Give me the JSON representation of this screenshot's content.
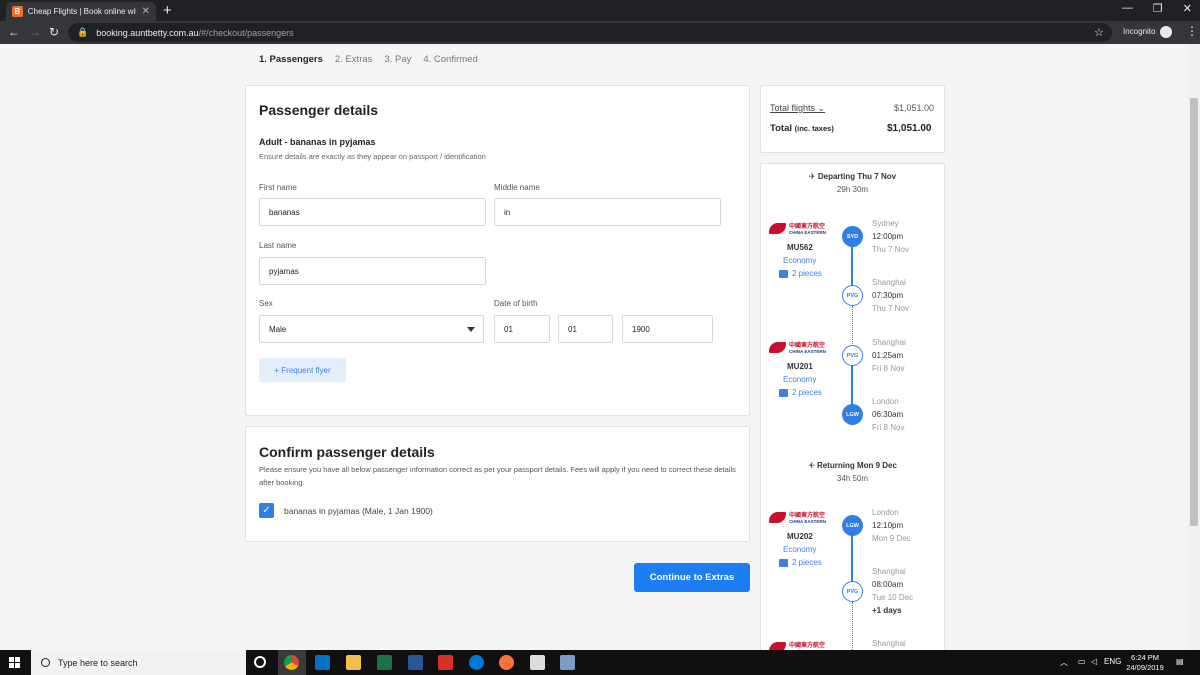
{
  "browser": {
    "tab_title": "Cheap Flights | Book online with",
    "tab_icon_letter": "B",
    "url_host": "booking.auntbetty.com.au",
    "url_path": "/#/checkout/passengers",
    "incognito_label": "Incognito"
  },
  "steps": [
    {
      "label": "1.  Passengers",
      "active": true
    },
    {
      "label": "2.  Extras",
      "active": false
    },
    {
      "label": "3.  Pay",
      "active": false
    },
    {
      "label": "4.  Confirmed",
      "active": false
    }
  ],
  "passenger": {
    "title": "Passenger details",
    "subtitle": "Adult - bananas in pyjamas",
    "note": "Ensure details are exactly as they appear on passport / identification",
    "first_name_label": "First name",
    "first_name": "bananas",
    "middle_name_label": "Middle name",
    "middle_name": "in",
    "last_name_label": "Last name",
    "last_name": "pyjamas",
    "sex_label": "Sex",
    "sex": "Male",
    "dob_label": "Date of birth",
    "dob_day": "01",
    "dob_month": "01",
    "dob_year": "1900",
    "frequent_flyer": "+  Frequent flyer"
  },
  "confirm": {
    "title": "Confirm passenger details",
    "text": "Please ensure you have all below passenger information correct as per your passport details. Fees will apply if you need to correct these details after booking.",
    "passenger_line": "bananas in pyjamas (Male, 1 Jan 1900)",
    "checked": true
  },
  "continue_label": "Continue to Extras",
  "summary": {
    "total_flights_label": "Total flights",
    "total_flights": "$1,051.00",
    "total_label": "Total",
    "total_suffix": "(inc. taxes)",
    "total": "$1,051.00"
  },
  "departing": {
    "heading": "Departing Thu 7 Nov",
    "duration": "29h 30m",
    "legs": [
      {
        "flight": "MU562",
        "cabin": "Economy",
        "bags": "2 pieces",
        "from": {
          "code": "SYD",
          "city": "Sydney",
          "time": "12:00pm",
          "date": "Thu 7 Nov"
        },
        "to": {
          "code": "PVG",
          "city": "Shanghai",
          "time": "07:30pm",
          "date": "Thu 7 Nov"
        }
      },
      {
        "flight": "MU201",
        "cabin": "Economy",
        "bags": "2 pieces",
        "from": {
          "code": "PVG",
          "city": "Shanghai",
          "time": "01:25am",
          "date": "Fri 8 Nov"
        },
        "to": {
          "code": "LGW",
          "city": "London",
          "time": "06:30am",
          "date": "Fri 8 Nov"
        }
      }
    ]
  },
  "returning": {
    "heading": "Returning Mon 9 Dec",
    "duration": "34h 50m",
    "legs": [
      {
        "flight": "MU202",
        "cabin": "Economy",
        "bags": "2 pieces",
        "from": {
          "code": "LGW",
          "city": "London",
          "time": "12:10pm",
          "date": "Mon 9 Dec"
        },
        "to": {
          "code": "PVG",
          "city": "Shanghai",
          "time": "08:00am",
          "date": "Tue 10 Dec",
          "plus": "+1 days"
        }
      }
    ],
    "next_city": "Shanghai"
  },
  "airline": {
    "name_cn": "中國東方航空",
    "name_en": "CHINA EASTERN"
  },
  "taskbar": {
    "search_placeholder": "Type here to search",
    "language": "ENG",
    "time": "6:24 PM",
    "date": "24/09/2019"
  }
}
